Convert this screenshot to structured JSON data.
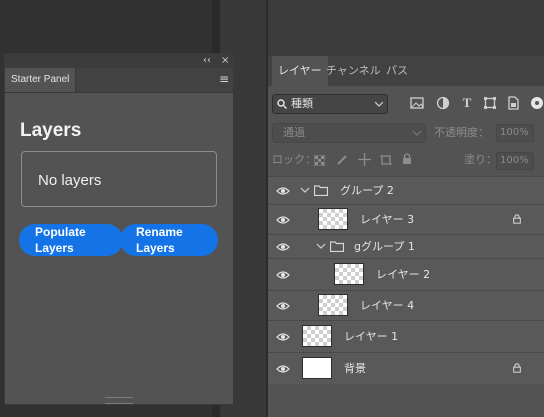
{
  "starter": {
    "tab": "Starter Panel",
    "top_left_btn": "‹‹",
    "top_close_btn": "×",
    "title": "Layers",
    "status": "No layers",
    "populate_btn": [
      "Populate",
      "Layers"
    ],
    "rename_btn": [
      "Rename",
      "Layers"
    ],
    "accent": "#1473e6"
  },
  "layers_panel": {
    "tabs": [
      "レイヤー",
      "チャンネル",
      "パス"
    ],
    "kind": "種類",
    "blend_mode": "通過",
    "opacity_label": "不透明度：",
    "opacity_value": "100%",
    "lock_label": "ロック：",
    "fill_label": "塗り：",
    "fill_value": "100%",
    "rows": [
      {
        "name": "グループ 2",
        "type": "group"
      },
      {
        "name": "レイヤー 3",
        "type": "layer",
        "locked": true
      },
      {
        "name": "gグループ 1",
        "type": "group"
      },
      {
        "name": "レイヤー 2",
        "type": "layer"
      },
      {
        "name": "レイヤー 4",
        "type": "layer"
      },
      {
        "name": "レイヤー 1",
        "type": "layer"
      },
      {
        "name": "背景",
        "type": "background",
        "locked": true
      }
    ]
  }
}
